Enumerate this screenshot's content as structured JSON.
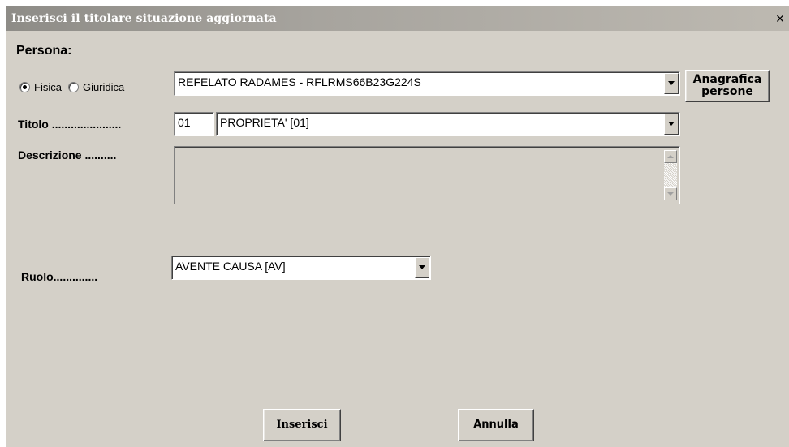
{
  "window": {
    "title": "Inserisci il titolare situazione aggiornata",
    "close_label": "×"
  },
  "persona": {
    "label": "Persona:",
    "radio_fisica": {
      "label": "Fisica",
      "checked": true
    },
    "radio_giuridica": {
      "label": "Giuridica",
      "checked": false
    },
    "selected_value": "REFELATO RADAMES - RFLRMS66B23G224S",
    "anagrafica_button": {
      "line1": "Anagrafica",
      "line2": "persone"
    }
  },
  "titolo": {
    "label": "Titolo ......................",
    "code": "01",
    "selected_value": "PROPRIETA' [01]"
  },
  "descrizione": {
    "label": "Descrizione ..........",
    "value": ""
  },
  "ruolo": {
    "label": "Ruolo..............",
    "selected_value": "AVENTE CAUSA [AV]"
  },
  "actions": {
    "inserisci_label": "Inserisci",
    "annulla_label": "Annulla"
  }
}
